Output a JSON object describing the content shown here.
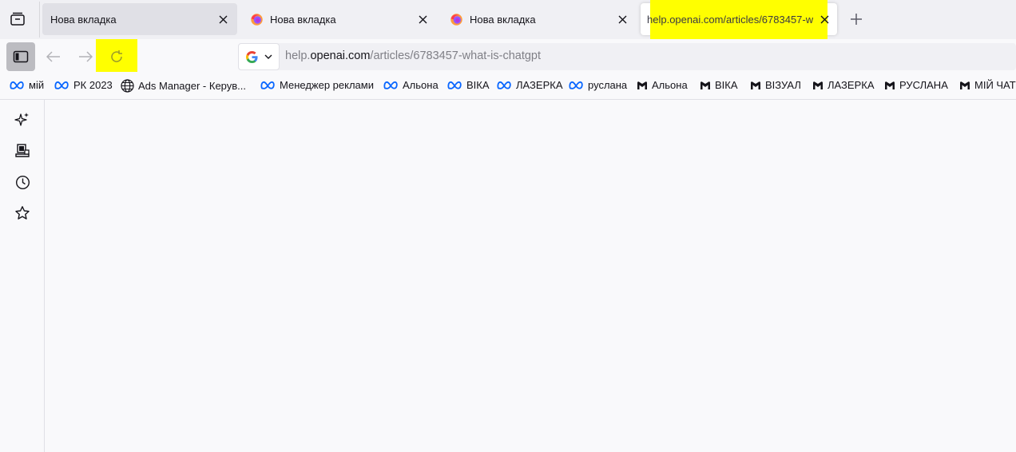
{
  "tabstrip": {
    "tabs": [
      {
        "title": "Нова вкладка",
        "favicon": "none"
      },
      {
        "title": "Нова вкладка",
        "favicon": "firefox-icon"
      },
      {
        "title": "Нова вкладка",
        "favicon": "firefox-icon"
      },
      {
        "title": "help.openai.com/articles/6783457-w",
        "favicon": "none",
        "active": true
      }
    ],
    "highlight_color": "#ffff00"
  },
  "navbar": {
    "url_host_prefix": "help.",
    "url_host": "openai.com",
    "url_path": "/articles/6783457-what-is-chatgpt",
    "search_engine": "google-icon"
  },
  "bookmarks": [
    {
      "label": "мій",
      "icon": "meta-icon"
    },
    {
      "label": "РК 2023",
      "icon": "meta-icon"
    },
    {
      "label": "Ads Manager - Керув...",
      "icon": "globe-icon"
    },
    {
      "label": "Менеджер реклами",
      "icon": "meta-icon"
    },
    {
      "label": "Альона",
      "icon": "meta-icon"
    },
    {
      "label": "ВІКА",
      "icon": "meta-icon"
    },
    {
      "label": "ЛАЗЕРКА",
      "icon": "meta-icon"
    },
    {
      "label": "руслана",
      "icon": "meta-icon"
    },
    {
      "label": "Альона",
      "icon": "m-icon"
    },
    {
      "label": "ВІКА",
      "icon": "m-icon"
    },
    {
      "label": "ВІЗУАЛ",
      "icon": "m-icon"
    },
    {
      "label": "ЛАЗЕРКА",
      "icon": "m-icon"
    },
    {
      "label": "РУСЛАНА",
      "icon": "m-icon"
    },
    {
      "label": "МІЙ ЧАТ",
      "icon": "m-icon"
    }
  ],
  "sidebar": {
    "items": [
      "ai-chatbot-icon",
      "synced-tabs-icon",
      "history-icon",
      "bookmarks-icon"
    ]
  }
}
